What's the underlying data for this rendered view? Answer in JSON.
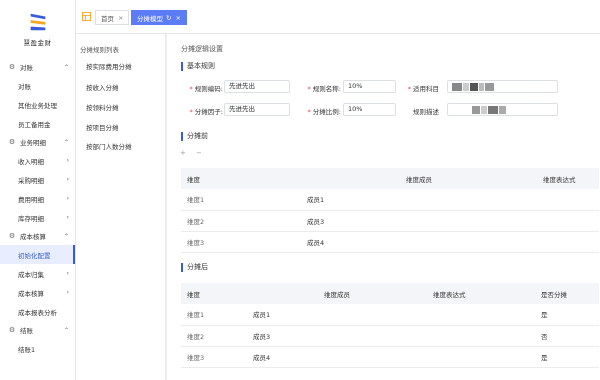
{
  "app": {
    "logo_text": "慧盈金财",
    "accent": "#3a5bd9"
  },
  "sidebar": {
    "groups": [
      {
        "label": "对账",
        "icon": "gear-icon",
        "items": [
          {
            "label": "对账",
            "caret": ""
          },
          {
            "label": "其他业务处理",
            "caret": ""
          },
          {
            "label": "员工备用金",
            "caret": ""
          }
        ]
      },
      {
        "label": "业务明细",
        "icon": "gear-icon",
        "items": [
          {
            "label": "收入明细",
            "caret": "›"
          },
          {
            "label": "采购明细",
            "caret": "›"
          },
          {
            "label": "费用明细",
            "caret": "›"
          },
          {
            "label": "库存明细",
            "caret": "›"
          }
        ]
      },
      {
        "label": "成本核算",
        "icon": "gear-icon",
        "items": [
          {
            "label": "初始化配置",
            "caret": ""
          },
          {
            "label": "成本归集",
            "caret": "›"
          },
          {
            "label": "成本核算",
            "caret": "›"
          },
          {
            "label": "成本报表分析",
            "caret": ""
          }
        ]
      },
      {
        "label": "结账",
        "icon": "gear-icon",
        "items": [
          {
            "label": "结账1",
            "caret": ""
          }
        ]
      }
    ]
  },
  "tabs": [
    {
      "label": "首页",
      "close": "×"
    },
    {
      "label": "分摊模型",
      "refresh": "↻",
      "close": "×"
    }
  ],
  "rule_list": {
    "title": "分摊规则列表",
    "items": [
      "按实际费用分摊",
      "按收入分摊",
      "按领料分摊",
      "按项目分摊",
      "按部门人数分摊"
    ]
  },
  "main": {
    "title": "分摊逻辑设置",
    "basic_rules": {
      "title": "基本规则",
      "rule_code_label": "规则编码:",
      "rule_code_value": "先进先出",
      "rule_name_label": "规则名称:",
      "rule_name_value": "10%",
      "account_label": "适用科目",
      "factor_label": "分摊因子:",
      "factor_value": "先进先出",
      "ratio_label": "分摊比例:",
      "ratio_value": "10%",
      "desc_label": "规则描述"
    },
    "before": {
      "title": "分摊前",
      "headers": [
        "维度",
        "维度成员",
        "维度表达式"
      ],
      "rows": [
        [
          "维度1",
          "成员1",
          ""
        ],
        [
          "维度2",
          "成员3",
          ""
        ],
        [
          "维度3",
          "成员4",
          ""
        ]
      ],
      "add_icon": "+",
      "remove_icon": "−"
    },
    "after": {
      "title": "分摊后",
      "headers": [
        "维度",
        "维度成员",
        "维度表达式",
        "是否分摊"
      ],
      "rows": [
        [
          "维度1",
          "成员1",
          "",
          "是"
        ],
        [
          "维度2",
          "成员3",
          "",
          "否"
        ],
        [
          "维度3",
          "成员4",
          "",
          "是"
        ]
      ]
    }
  }
}
